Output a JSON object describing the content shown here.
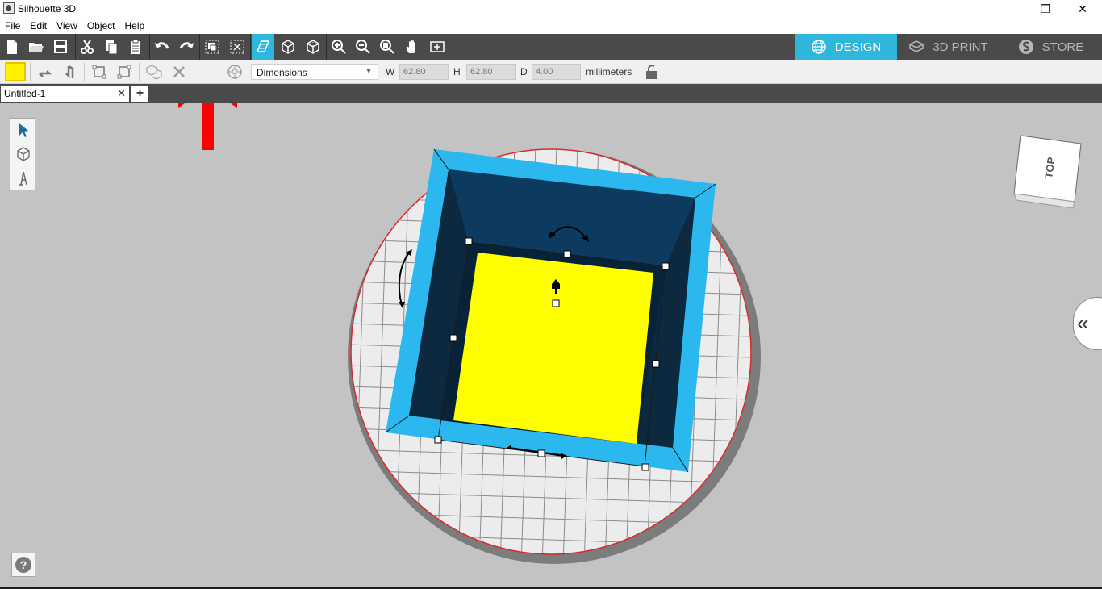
{
  "window": {
    "title": "Silhouette 3D",
    "minimize_glyph": "—",
    "restore_glyph": "❐",
    "close_glyph": "✕"
  },
  "menu": [
    "File",
    "Edit",
    "View",
    "Object",
    "Help"
  ],
  "toolbar": {
    "icons": [
      "new-file-icon",
      "open-folder-icon",
      "save-icon",
      "cut-icon",
      "copy-icon",
      "paste-icon",
      "undo-icon",
      "redo-icon",
      "group-icon",
      "ungroup-icon",
      "perspective-view-icon",
      "cube-view-icon",
      "cube-outline-view-icon",
      "zoom-in-icon",
      "zoom-out-icon",
      "zoom-fit-icon",
      "pan-hand-icon",
      "fit-to-page-icon"
    ],
    "tabs": [
      {
        "label": "DESIGN",
        "icon": "globe-icon",
        "active": true
      },
      {
        "label": "3D PRINT",
        "icon": "print-box-icon",
        "active": false
      },
      {
        "label": "STORE",
        "icon": "store-icon",
        "active": false
      }
    ],
    "accent_color": "#2fb6dc"
  },
  "subtoolbar": {
    "fill_color": "#fff200",
    "dimension_mode": "Dimensions",
    "w_label": "W",
    "w_value": "62.80",
    "h_label": "H",
    "h_value": "62.80",
    "d_label": "D",
    "d_value": "4.00",
    "units": "millimeters"
  },
  "document": {
    "tab_title": "Untitled-1",
    "tab_close": "✕",
    "add_tab": "+"
  },
  "canvas": {
    "view_cube_label": "TOP",
    "help_glyph": "?",
    "panel_toggle_glyph": "«",
    "box_color": "#2ab8ef",
    "inner_color": "#0e3a5c",
    "floor_color": "#ffff00"
  }
}
